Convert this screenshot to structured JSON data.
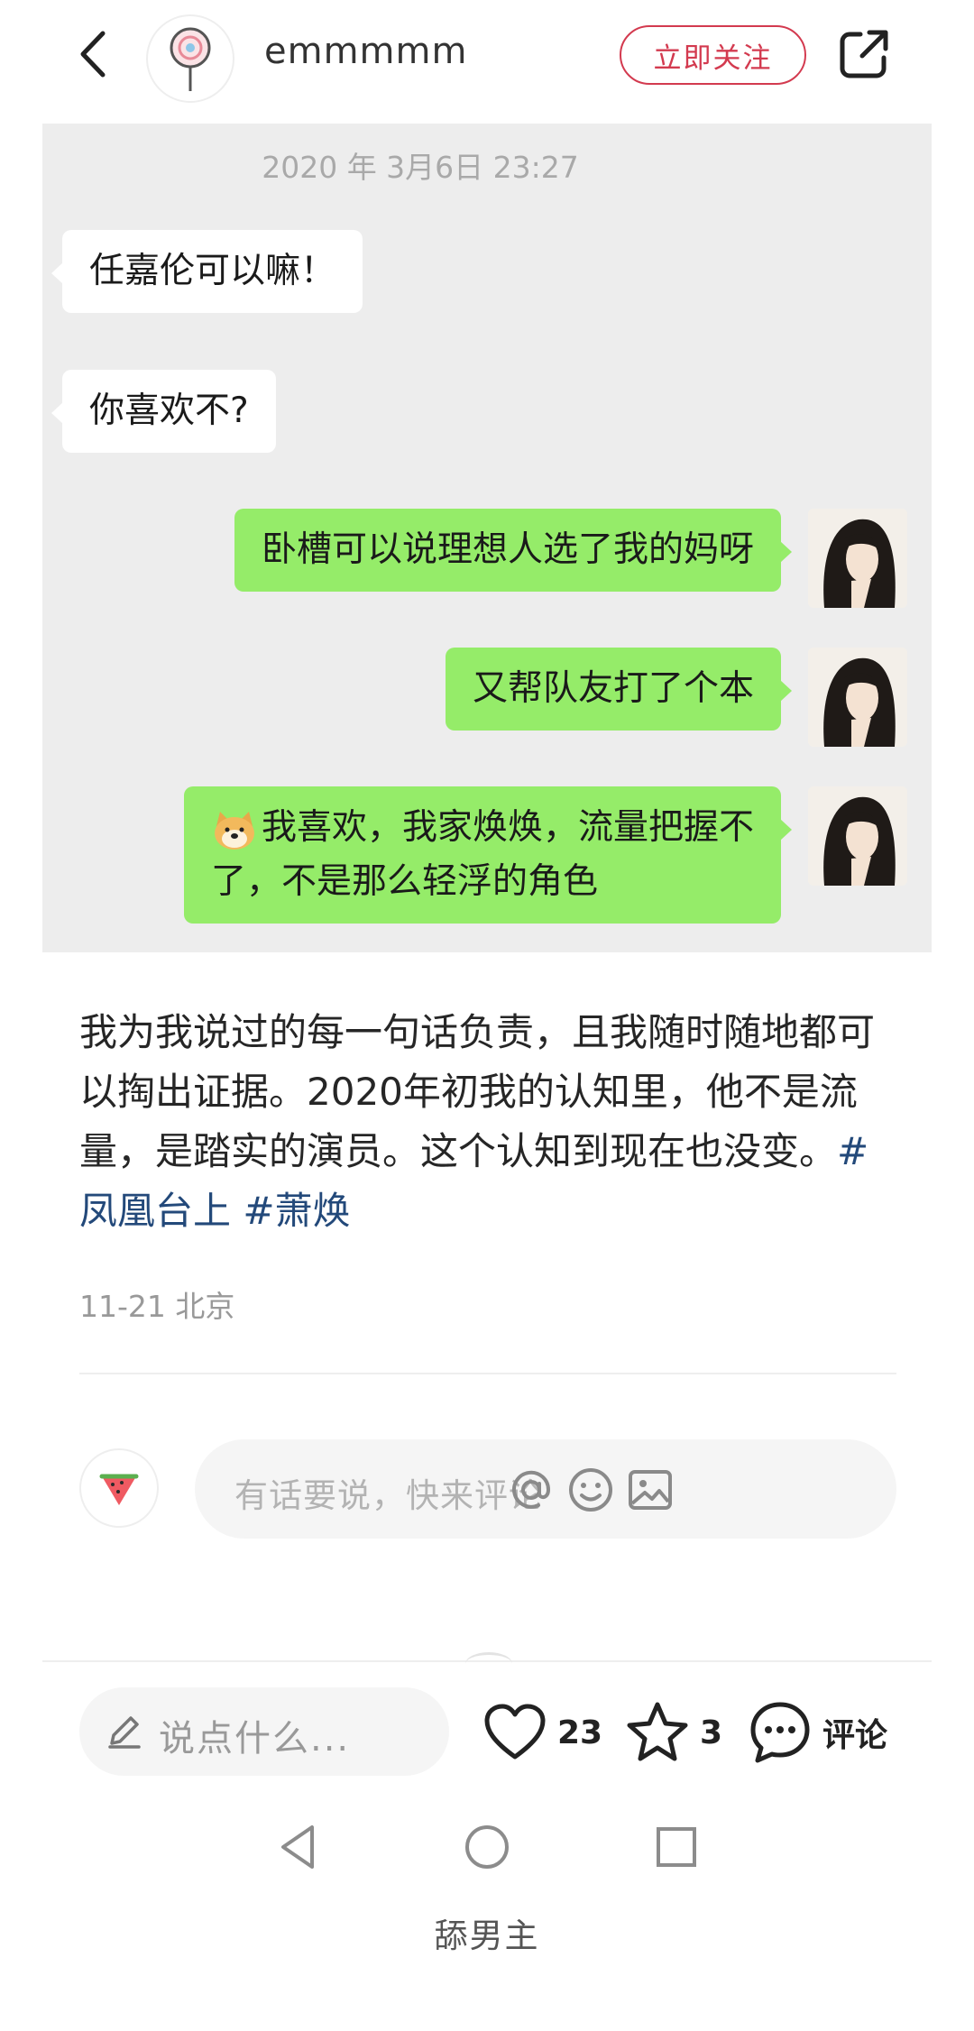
{
  "header": {
    "username": "emmmmm",
    "follow_label": "立即关注"
  },
  "chat": {
    "timestamp": "2020 年 3月6日 23:27",
    "messages": [
      {
        "side": "left",
        "text": "任嘉伦可以嘛！"
      },
      {
        "side": "left",
        "text": "你喜欢不?"
      },
      {
        "side": "right",
        "text": "卧槽可以说理想人选了我的妈呀"
      },
      {
        "side": "right",
        "text": "又帮队友打了个本"
      },
      {
        "side": "right",
        "line1": "我喜欢，我家焕焕，流量把握不",
        "line2": "了，不是那么轻浮的角色"
      }
    ]
  },
  "post": {
    "body": "我为我说过的每一句话负责，且我随时随地都可以掏出证据。2020年初我的认知里，他不是流量，是踏实的演员。这个认知到现在也没变。",
    "hashtags": [
      "#凤凰台上",
      "#萧焕"
    ],
    "date": "11-21",
    "location": "北京"
  },
  "comment": {
    "placeholder": "有话要说，快来评论"
  },
  "actions": {
    "say_placeholder": "说点什么...",
    "likes": "23",
    "stars": "3",
    "comment_label": "评论"
  },
  "footer": {
    "label": "舔男主"
  },
  "colors": {
    "accent": "#d33a4f",
    "chat_bg": "#ededed",
    "bubble_green": "#95ec69",
    "hashtag": "#23497a"
  }
}
